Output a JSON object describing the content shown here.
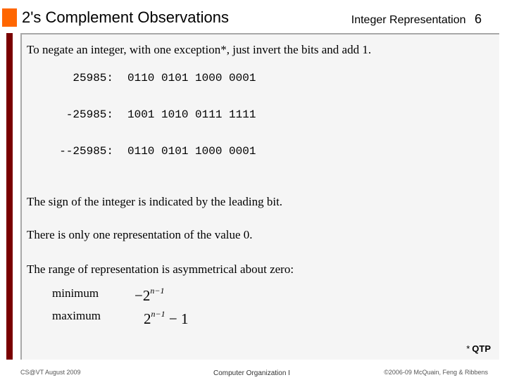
{
  "header": {
    "title": "2's Complement Observations",
    "section": "Integer Representation",
    "page_number": "6",
    "accent_color": "#ff6600",
    "bar_color": "#7a0000"
  },
  "content": {
    "intro": "To negate an integer, with one exception*, just invert the bits and add 1.",
    "code_rows": [
      {
        "label": "25985:",
        "bits": "0110 0101 1000 0001"
      },
      {
        "label": "-25985:",
        "bits": "1001 1010 0111 1111"
      },
      {
        "label": "--25985:",
        "bits": "0110 0101 1000 0001"
      }
    ],
    "sign_note": "The sign of the integer is indicated by the leading bit.",
    "zero_note": "There is only one representation of the value 0.",
    "range_note": "The range of representation is asymmetrical about zero:",
    "range": {
      "min_label": "minimum",
      "min_expr_prefix": "−2",
      "min_expr_exp": "n−1",
      "max_label": "maximum",
      "max_expr_base": "2",
      "max_expr_exp": "n−1",
      "max_expr_suffix": " − 1"
    },
    "footnote_star": "*",
    "footnote_text": "QTP"
  },
  "footer": {
    "left": "CS@VT August 2009",
    "center": "Computer Organization I",
    "right": "©2006-09  McQuain, Feng & Ribbens"
  }
}
